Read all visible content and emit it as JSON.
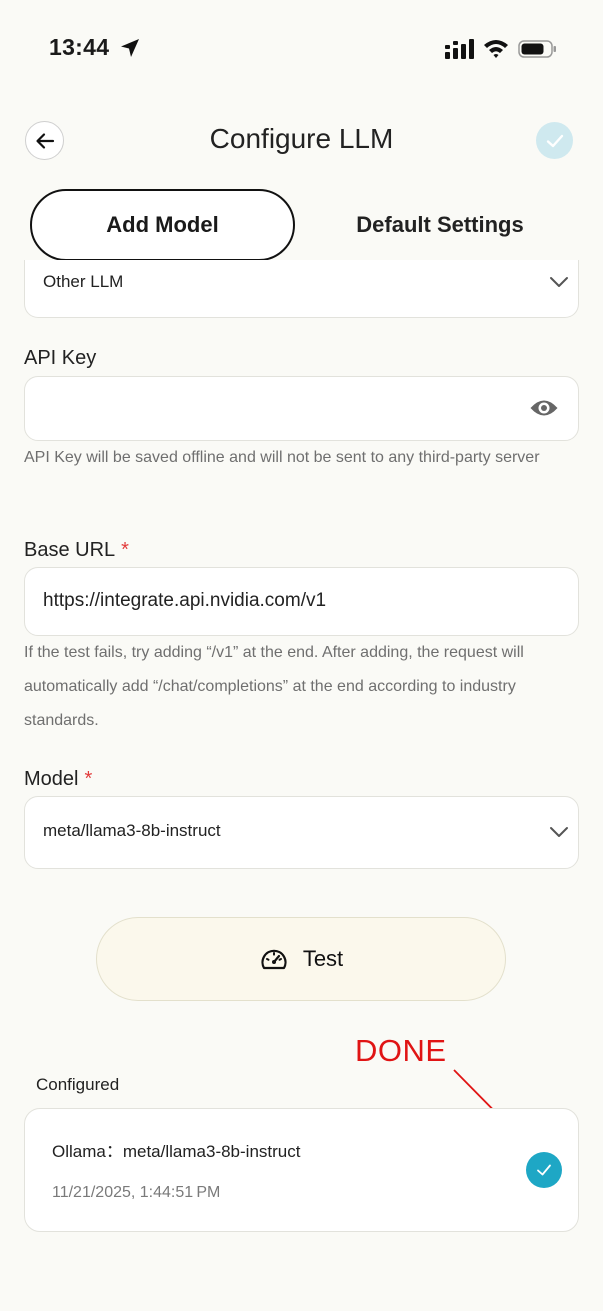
{
  "status_bar": {
    "time": "13:44",
    "icons": [
      "location-arrow-icon",
      "signal-icon",
      "wifi-icon",
      "battery-icon"
    ]
  },
  "header": {
    "title": "Configure LLM",
    "back_icon": "arrow-left-icon",
    "confirm_icon": "check-icon"
  },
  "tabs": [
    {
      "label": "Add Model",
      "active": true
    },
    {
      "label": "Default Settings",
      "active": false
    }
  ],
  "form": {
    "provider": {
      "value": "Other LLM"
    },
    "api_key": {
      "label": "API Key",
      "value": "",
      "hint": "API Key will be saved offline and will not be sent to any third-party server"
    },
    "base_url": {
      "label": "Base URL",
      "required_mark": "*",
      "value": "https://integrate.api.nvidia.com/v1",
      "hint": "If the test fails, try adding “/v1” at the end. After adding, the request will automatically add “/chat/completions” at the end according to industry standards."
    },
    "model": {
      "label": "Model",
      "required_mark": "*",
      "value": "meta/llama3-8b-instruct"
    }
  },
  "test_button": {
    "label": "Test",
    "icon": "speedometer-icon"
  },
  "annotation": {
    "text": "DONE",
    "color": "#e01414"
  },
  "configured": {
    "heading": "Configured",
    "items": [
      {
        "title": "Ollama：meta/llama3-8b-instruct",
        "date": "11/21/2025, 1:44:51 PM",
        "selected": true
      }
    ]
  },
  "colors": {
    "background": "#fafaf6",
    "accent": "#1ea7c5",
    "confirm_bg": "#cfe9ef",
    "required": "#e23b3b",
    "test_bg": "#fbf8ec"
  }
}
